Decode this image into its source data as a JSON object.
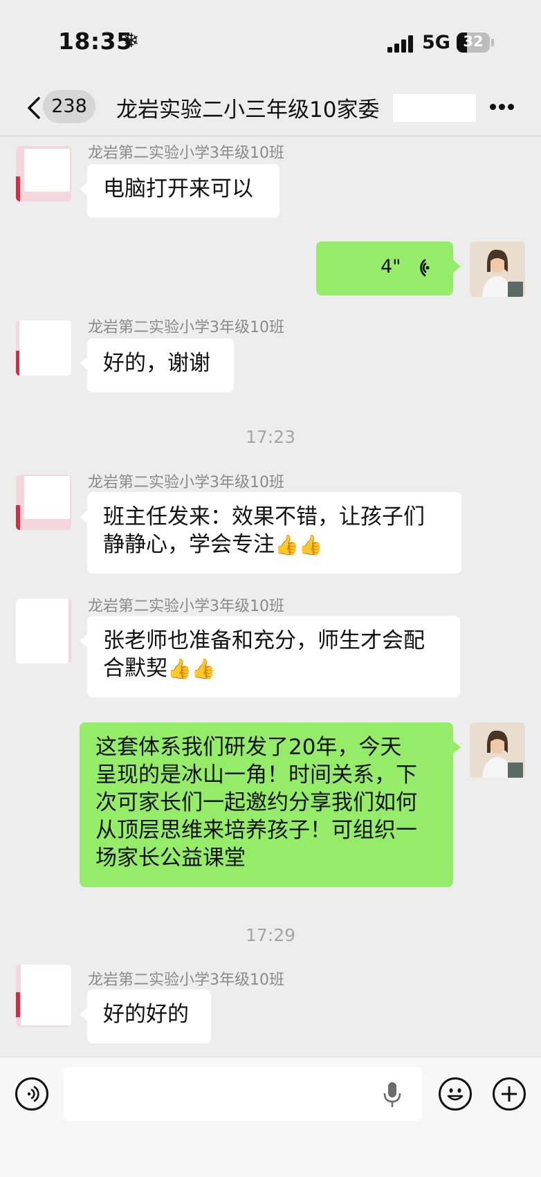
{
  "status_bar": {
    "time": "18:35",
    "network": "5G",
    "battery": "32",
    "battery_level": 0.32
  },
  "header": {
    "unread_count": "238",
    "title": "龙岩实验二小三年级10家委"
  },
  "messages": [
    {
      "sender": "龙岩第二实验小学3年级10班",
      "text": "电脑打开来可以"
    },
    {
      "voice_duration": "4\""
    },
    {
      "sender": "龙岩第二实验小学3年级10班",
      "text": "好的，谢谢"
    },
    {
      "timestamp": "17:23"
    },
    {
      "sender": "龙岩第二实验小学3年级10班",
      "text": "班主任发来：效果不错，让孩子们\n静静心，学会专注",
      "emoji": "👍👍"
    },
    {
      "sender": "龙岩第二实验小学3年级10班",
      "text": "张老师也准备和充分，师生才会配\n合默契",
      "emoji": "👍👍"
    },
    {
      "text": "这套体系我们研发了20年，今天\n呈现的是冰山一角！时间关系，下\n次可家长们一起邀约分享我们如何\n从顶层思维来培养孩子！可组织一\n场家长公益课堂"
    },
    {
      "timestamp": "17:29"
    },
    {
      "sender": "龙岩第二实验小学3年级10班",
      "text": "好的好的"
    }
  ],
  "input": {
    "placeholder": ""
  },
  "colors": {
    "background": "#ededed",
    "outgoing_bubble": "#95ec69",
    "incoming_bubble": "#ffffff"
  }
}
